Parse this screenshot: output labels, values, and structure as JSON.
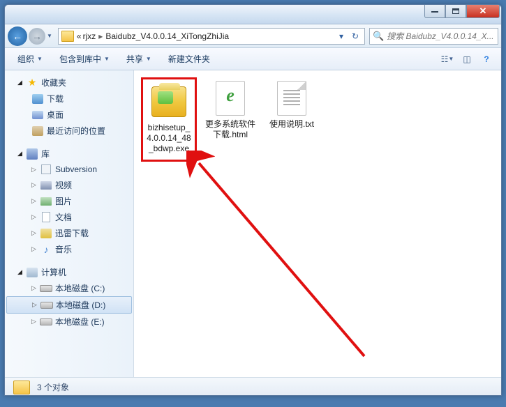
{
  "breadcrumb": {
    "prefix": "«",
    "parts": [
      "rjxz",
      "Baidubz_V4.0.0.14_XiTongZhiJia"
    ]
  },
  "search": {
    "placeholder": "搜索 Baidubz_V4.0.0.14_X..."
  },
  "toolbar": {
    "organize": "组织",
    "include": "包含到库中",
    "share": "共享",
    "newfolder": "新建文件夹"
  },
  "sidebar": {
    "favorites": {
      "label": "收藏夹",
      "items": [
        "下载",
        "桌面",
        "最近访问的位置"
      ]
    },
    "libraries": {
      "label": "库",
      "items": [
        "Subversion",
        "视频",
        "图片",
        "文档",
        "迅雷下载",
        "音乐"
      ]
    },
    "computer": {
      "label": "计算机",
      "items": [
        "本地磁盘 (C:)",
        "本地磁盘 (D:)",
        "本地磁盘 (E:)"
      ]
    }
  },
  "files": [
    {
      "name": "bizhisetup_4.0.0.14_48_bdwp.exe",
      "type": "installer",
      "highlighted": true
    },
    {
      "name": "更多系统软件下载.html",
      "type": "html",
      "highlighted": false
    },
    {
      "name": "使用说明.txt",
      "type": "txt",
      "highlighted": false
    }
  ],
  "status": {
    "count_text": "3 个对象"
  }
}
